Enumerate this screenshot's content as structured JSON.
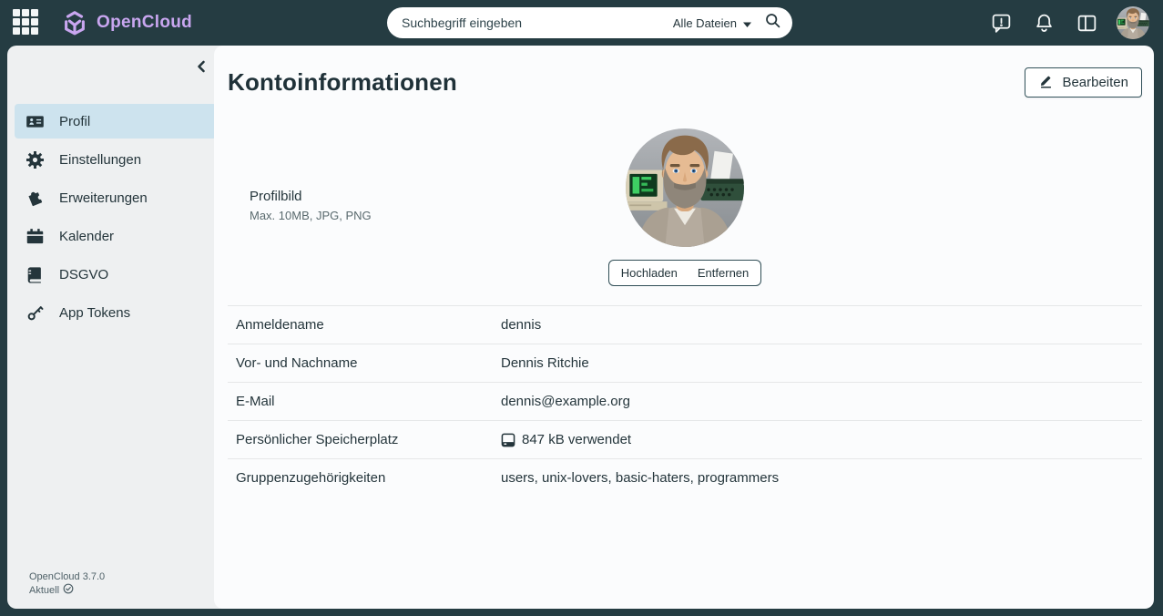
{
  "topbar": {
    "app_name": "OpenCloud",
    "search": {
      "placeholder": "Suchbegriff eingeben",
      "scope_label": "Alle Dateien"
    }
  },
  "sidebar": {
    "items": [
      {
        "label": "Profil",
        "active": true
      },
      {
        "label": "Einstellungen",
        "active": false
      },
      {
        "label": "Erweiterungen",
        "active": false
      },
      {
        "label": "Kalender",
        "active": false
      },
      {
        "label": "DSGVO",
        "active": false
      },
      {
        "label": "App Tokens",
        "active": false
      }
    ],
    "footer": {
      "version": "OpenCloud 3.7.0",
      "status": "Aktuell"
    }
  },
  "main": {
    "title": "Kontoinformationen",
    "edit_button": "Bearbeiten",
    "profile_picture": {
      "label": "Profilbild",
      "hint": "Max. 10MB, JPG, PNG",
      "upload_button": "Hochladen",
      "remove_button": "Entfernen"
    },
    "fields": [
      {
        "label": "Anmeldename",
        "value": "dennis"
      },
      {
        "label": "Vor- und Nachname",
        "value": "Dennis Ritchie"
      },
      {
        "label": "E-Mail",
        "value": "dennis@example.org"
      },
      {
        "label": "Persönlicher Speicherplatz",
        "value": "847 kB verwendet",
        "icon": "hard-drive-icon"
      },
      {
        "label": "Gruppenzugehörigkeiten",
        "value": "users, unix-lovers, basic-haters, programmers"
      }
    ]
  },
  "colors": {
    "topbar_bg": "#253c42",
    "brand_lavender": "#c9a6f0",
    "sidebar_bg": "#eef0f1",
    "active_item_bg": "#cde3ee",
    "main_bg": "#fbfcfd",
    "text_dark": "#24353b",
    "text_gray": "#5a6a6e",
    "divider": "#e5e7e8"
  }
}
